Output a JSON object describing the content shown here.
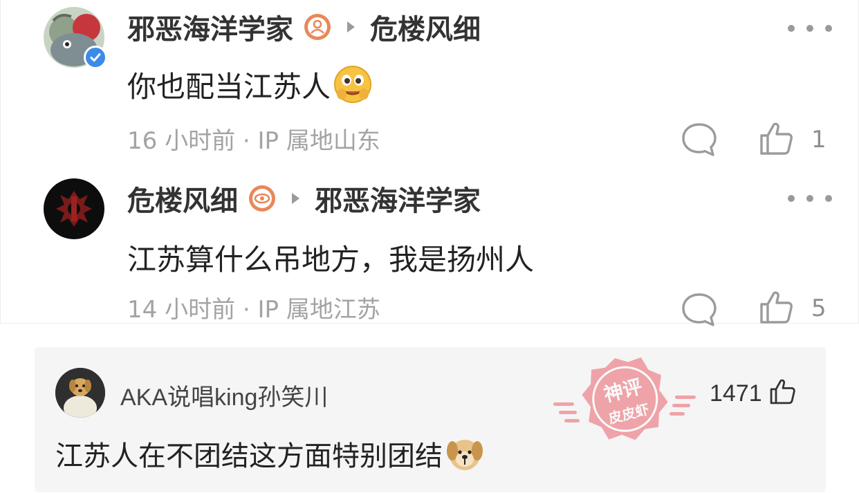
{
  "replies": [
    {
      "username": "邪恶海洋学家",
      "reply_to": "危楼风细",
      "content": "你也配当江苏人",
      "emoji": "drooling-face-emoji",
      "time": "16 小时前",
      "ip": "IP 属地山东",
      "likes": "1",
      "badge": "level-badge-orange",
      "verified": true
    },
    {
      "username": "危楼风细",
      "reply_to": "邪恶海洋学家",
      "content": "江苏算什么吊地方，我是扬州人",
      "time": "14 小时前",
      "ip": "IP 属地江苏",
      "likes": "5",
      "badge": "level-badge-orange"
    }
  ],
  "quoted_comment": {
    "username": "AKA说唱king孙笑川",
    "likes": "1471",
    "content": "江苏人在不团结这方面特别团结",
    "emoji": "dog-face-emoji"
  },
  "watermark": {
    "line1": "神评",
    "line2": "皮皮虾"
  },
  "colors": {
    "meta_gray": "#a3a3a3",
    "verified_blue": "#3c8be8",
    "badge_orange": "#e8885a",
    "card_bg": "#f5f5f5",
    "watermark_red": "#e8535e"
  },
  "meta_separator": " · "
}
